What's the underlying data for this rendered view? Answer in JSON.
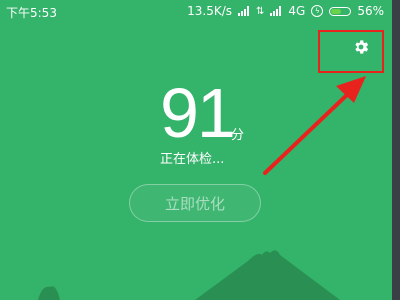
{
  "status_bar": {
    "time": "下午5:53",
    "net_speed": "13.5K/s",
    "network_type": "4G",
    "battery_percent": "56%",
    "battery_level": 0.56
  },
  "main": {
    "score": "91",
    "score_unit": "分",
    "status": "正在体检...",
    "optimize_button": "立即优化"
  },
  "colors": {
    "background": "#34b36a",
    "annotation": "#e8231e",
    "mountain": "#2a8f52"
  },
  "icons": {
    "settings": "gear-icon"
  }
}
